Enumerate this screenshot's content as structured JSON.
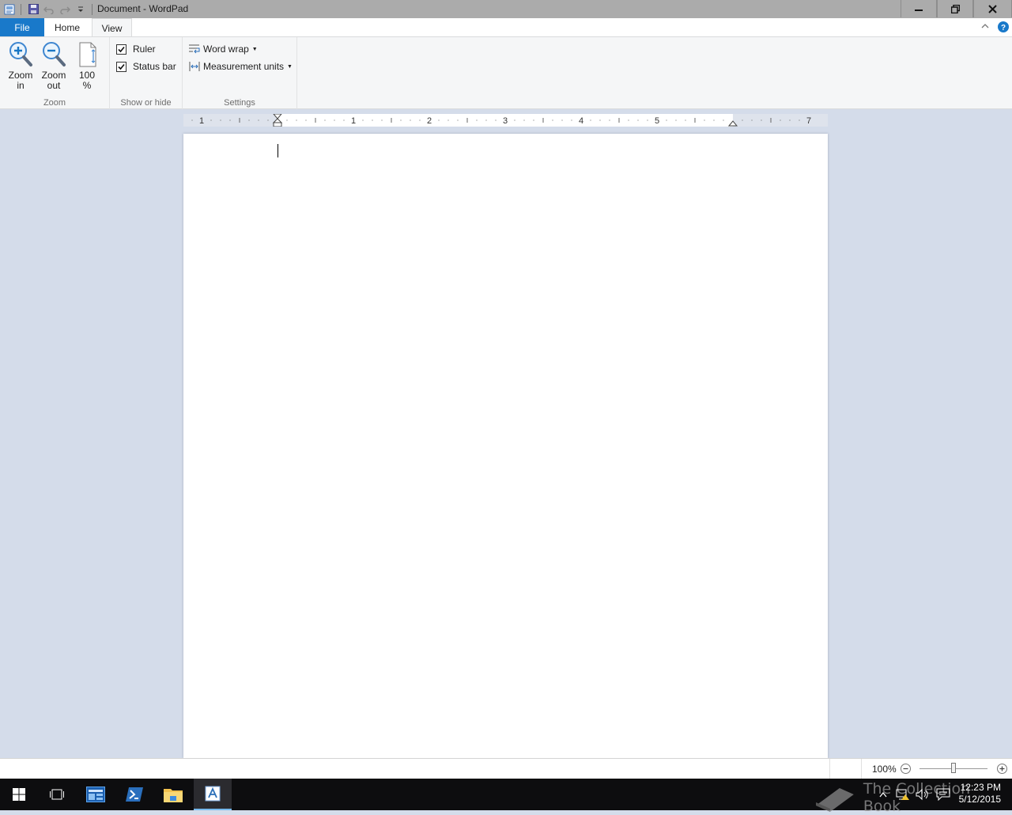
{
  "window": {
    "title": "Document - WordPad",
    "buttons": {
      "minimize": "minimize-icon",
      "restore": "restore-icon",
      "close": "close-icon"
    }
  },
  "ribbon_tabs": {
    "file": "File",
    "home": "Home",
    "view": "View",
    "active": "View"
  },
  "ribbon": {
    "zoom_group": {
      "label": "Zoom",
      "zoom_in_line1": "Zoom",
      "zoom_in_line2": "in",
      "zoom_out_line1": "Zoom",
      "zoom_out_line2": "out",
      "hundred_line1": "100",
      "hundred_line2": "%"
    },
    "show_hide_group": {
      "label": "Show or hide",
      "ruler": {
        "label": "Ruler",
        "checked": true
      },
      "status_bar": {
        "label": "Status bar",
        "checked": true
      }
    },
    "settings_group": {
      "label": "Settings",
      "word_wrap": "Word wrap",
      "measurement_units": "Measurement units"
    }
  },
  "ruler": {
    "numbers": [
      "1",
      "1",
      "2",
      "3",
      "4",
      "5",
      "7"
    ]
  },
  "statusbar": {
    "zoom": "100%",
    "zoom_level": 1.0
  },
  "taskbar": {
    "time": "12:23 PM",
    "date": "5/12/2015",
    "watermark": "The Collection Book"
  },
  "colors": {
    "accent_file_tab": "#1979ca",
    "titlebar": "#ababab",
    "workspace": "#d4dcea",
    "taskbar": "#0d0d0f"
  }
}
